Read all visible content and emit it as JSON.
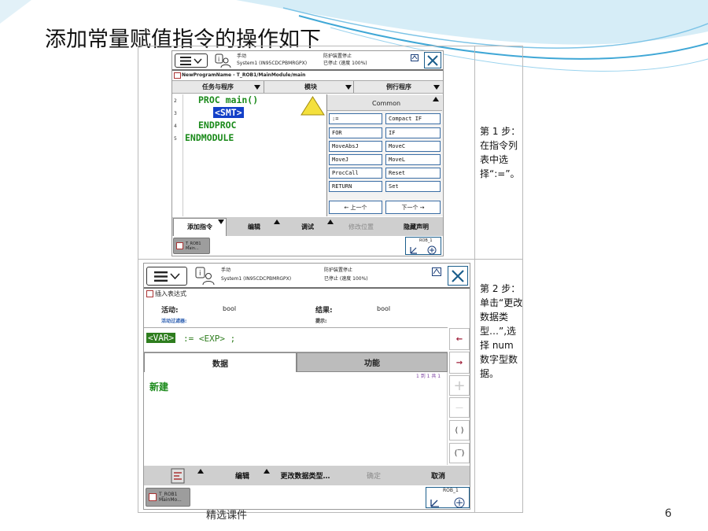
{
  "slide": {
    "title": "添加常量赋值指令的操作如下",
    "footer": "精选课件",
    "page_number": "6"
  },
  "steps": [
    {
      "text": "第 1 步：在指令列表中选择“:=”。"
    },
    {
      "text": "第 2 步：单击“更改数据类型…”,选择 num 数字型数据。"
    }
  ],
  "screen1": {
    "status": {
      "mode": "手动",
      "system": "System1 (IN95CDCPBMRGPX)",
      "guard": "防护装置停止",
      "state": "已停止 (速度 100%)"
    },
    "program_path": "NewProgramName - T_ROB1/MainModule/main",
    "tabs": [
      "任务与程序",
      "模块",
      "例行程序"
    ],
    "code_lines": [
      {
        "num": "2",
        "text": "PROC main()"
      },
      {
        "num": "3",
        "text": "<SMT>"
      },
      {
        "num": "4",
        "text": "ENDPROC"
      },
      {
        "num": "5",
        "text": "ENDMODULE"
      }
    ],
    "instruction_panel": {
      "header": "Common",
      "items": [
        ":=",
        "Compact IF",
        "FOR",
        "IF",
        "MoveAbsJ",
        "MoveC",
        "MoveJ",
        "MoveL",
        "ProcCall",
        "Reset",
        "RETURN",
        "Set"
      ],
      "prev": "←  上一个",
      "next": "下一个  →"
    },
    "bottom_tabs": [
      "添加指令",
      "编辑",
      "调试",
      "修改位置",
      "隐藏声明"
    ],
    "taskbar": {
      "line1": "T_ROB1",
      "line2": "Main..."
    },
    "rob_label": "ROB_1"
  },
  "screen2": {
    "status": {
      "mode": "手动",
      "system": "System1 (IN95CDCPBMRGPX)",
      "guard": "防护装置停止",
      "state": "已停止 (速度 100%)"
    },
    "page_title": "插入表达式",
    "active_label": "活动:",
    "active_value": "bool",
    "result_label": "结果:",
    "result_value": "bool",
    "filter_label": "活动过滤器:",
    "hint_label": "提示:",
    "expr_var": "<VAR>",
    "expr_rest": ":= <EXP> ;",
    "tab_data": "数据",
    "tab_func": "功能",
    "page_info": "1 到 1 共 1",
    "new_item": "新建",
    "side_buttons": [
      "←",
      "→",
      "+",
      "—",
      "( )",
      "(‾)"
    ],
    "bottom_tabs": [
      "编辑",
      "更改数据类型…",
      "确定",
      "取消"
    ],
    "taskbar": {
      "line1": "T_ROB1",
      "line2": "MainMo..."
    },
    "rob_label": "ROB_1"
  },
  "colors": {
    "code_green": "#1a8a1a",
    "select_blue": "#1340c8",
    "var_green": "#2e7d1e",
    "swoosh_blue": "#3fa7d6"
  }
}
